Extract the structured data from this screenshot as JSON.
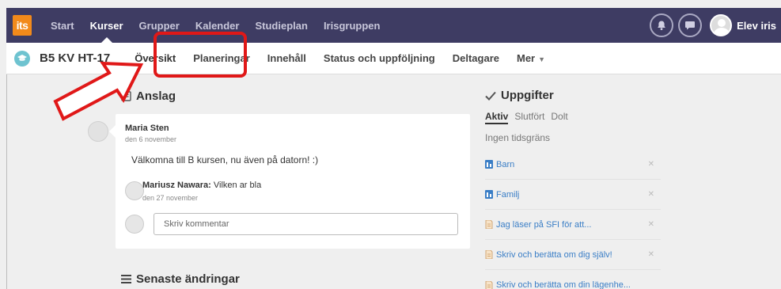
{
  "topnav": {
    "logo": "its",
    "items": [
      {
        "label": "Start"
      },
      {
        "label": "Kurser"
      },
      {
        "label": "Grupper"
      },
      {
        "label": "Kalender"
      },
      {
        "label": "Studieplan"
      },
      {
        "label": "Irisgruppen"
      }
    ],
    "user_name": "Elev iris"
  },
  "course": {
    "title": "B5 KV HT-17",
    "tabs": [
      {
        "label": "Översikt"
      },
      {
        "label": "Planeringar"
      },
      {
        "label": "Innehåll"
      },
      {
        "label": "Status och uppföljning"
      },
      {
        "label": "Deltagare"
      },
      {
        "label": "Mer"
      }
    ]
  },
  "anslag": {
    "title": "Anslag",
    "post": {
      "author": "Maria Sten",
      "date": "den 6 november",
      "text": "Välkomna till B kursen, nu även på datorn! :)"
    },
    "comment": {
      "author": "Mariusz Nawara:",
      "text": "Vilken ar bla",
      "date": "den 27 november"
    },
    "comment_placeholder": "Skriv kommentar"
  },
  "senaste": {
    "title": "Senaste ändringar"
  },
  "uppgifter": {
    "title": "Uppgifter",
    "tabs": [
      "Aktiv",
      "Slutfört",
      "Dolt"
    ],
    "no_deadline": "Ingen tidsgräns",
    "items": [
      {
        "label": "Barn",
        "icon": "module-icon"
      },
      {
        "label": "Familj",
        "icon": "module-icon"
      },
      {
        "label": "Jag läser på SFI för att...",
        "icon": "document-icon"
      },
      {
        "label": "Skriv och berätta om dig själv!",
        "icon": "document-icon"
      },
      {
        "label": "Skriv och berätta om din lägenhe...",
        "icon": "document-icon"
      }
    ]
  },
  "colors": {
    "topbar": "#3e3c63",
    "logo": "#f28a1b",
    "link": "#3a7ec6",
    "annotation": "#e01818"
  }
}
